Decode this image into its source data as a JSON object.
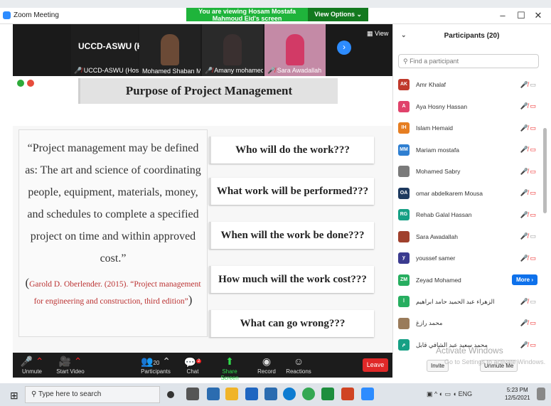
{
  "window": {
    "title": "Zoom Meeting",
    "minimize": "–",
    "maximize": "☐",
    "close": "✕"
  },
  "banner": {
    "message": "You are viewing Hosam Mostafa Mahmoud Eid's screen",
    "view_options": "View Options ⌄"
  },
  "video": {
    "main_label": "UCCD-ASWU (H...",
    "view_label": "View",
    "next": "›",
    "tiles": [
      {
        "name": "UCCD-ASWU (Host)"
      },
      {
        "name": "Mohamed Shaban Mah..."
      },
      {
        "name": "Amany mohamed"
      },
      {
        "name": "Sara Awadallah"
      }
    ]
  },
  "slide": {
    "title": "Purpose of Project Management",
    "quote": "“Project management may be defined as: The art and science of coordinating people, equipment, materials, money, and schedules to complete a specified project on time and within approved cost.”",
    "citation_open": "(",
    "citation": "Garold D. Oberlender. (2015). “Project management for engineering and construction, third edition”",
    "citation_close": ")",
    "questions": [
      "Who will do the work???",
      "What work will be performed???",
      "When will the work be done???",
      "How much will the work cost???",
      "What can go wrong???"
    ]
  },
  "toolbar": {
    "unmute": "Unmute",
    "start_video": "Start Video",
    "participants": "Participants",
    "participants_count": "20",
    "chat": "Chat",
    "chat_badge": "2",
    "share_screen": "Share Screen",
    "record": "Record",
    "reactions": "Reactions",
    "leave": "Leave"
  },
  "panel": {
    "title": "Participants (20)",
    "search_placeholder": "Find a participant",
    "invite": "Invite",
    "unmute_me": "Unmute Me",
    "more": "More ›",
    "participants": [
      {
        "initials": "AK",
        "name": "Amr Khalaf",
        "color": "#c0392b",
        "video": "off-grey"
      },
      {
        "initials": "A",
        "name": "Aya Hosny Hassan",
        "color": "#e0436b",
        "video": "off-red"
      },
      {
        "initials": "IH",
        "name": "Islam Hemaid",
        "color": "#e67e22",
        "video": "off-red"
      },
      {
        "initials": "MM",
        "name": "Mariam mostafa",
        "color": "#2f7fd1",
        "video": "off-red"
      },
      {
        "initials": "",
        "name": "Mohamed Sabry",
        "color": "#7a7a7a",
        "video": "off-red"
      },
      {
        "initials": "OA",
        "name": "omar abdelkarem Mousa",
        "color": "#1e3a5f",
        "video": "off-red"
      },
      {
        "initials": "RG",
        "name": "Rehab Galal Hassan",
        "color": "#16a085",
        "video": "off-red"
      },
      {
        "initials": "",
        "name": "Sara Awadallah",
        "color": "#a0412d",
        "video": "off-grey"
      },
      {
        "initials": "y",
        "name": "youssef samer",
        "color": "#3b3b8f",
        "video": "off-red"
      },
      {
        "initials": "ZM",
        "name": "Zeyad Mohamed",
        "color": "#27ae60",
        "video": "more"
      },
      {
        "initials": "ا",
        "name": "الزهراء عبد الحميد حامد ابراهيم",
        "color": "#27ae60",
        "video": "off-grey"
      },
      {
        "initials": "",
        "name": "محمد رازغ",
        "color": "#9a7b5a",
        "video": "off-red"
      },
      {
        "initials": "م",
        "name": "محمد سعيد عبد الشافي قابل",
        "color": "#16a085",
        "video": "off-red"
      }
    ]
  },
  "watermark": {
    "line1": "Activate Windows",
    "line2": "Go to Settings to activate Windows."
  },
  "taskbar": {
    "search_placeholder": "Type here to search",
    "lang": "ENG",
    "time": "5:23 PM",
    "date": "12/5/2021"
  },
  "colors": {
    "zoom_blue": "#2d8cff",
    "banner_green": "#1fb43b",
    "leave_red": "#e02828"
  }
}
